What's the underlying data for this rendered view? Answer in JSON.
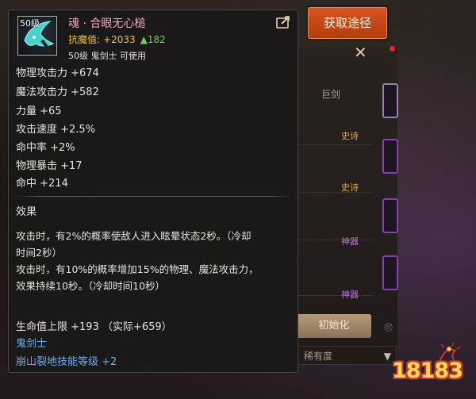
{
  "acquire_button": {
    "label": "获取途径"
  },
  "item": {
    "level_badge": "50级",
    "name": "魂 · 合眼无心槌",
    "resist_label": "抗魔值:",
    "resist_value": "+2033",
    "resist_change": "▲182",
    "level_line": "50级 鬼剑士 可使用",
    "stats": [
      "物理攻击力 +674",
      "魔法攻击力 +582",
      "力量 +65",
      "攻击速度 +2.5%",
      "命中率 +2%",
      "物理暴击 +17",
      "命中 +214"
    ],
    "effect_title": "效果",
    "effect_desc_1": [
      "攻击时，有2%的概率使敌人进入眩晕状态2秒。（冷却",
      "时间2秒）"
    ],
    "effect_desc_2": [
      "攻击时，有10%的概率增加15%的物理、魔法攻击力，",
      "效果持续10秒。（冷却时间10秒）"
    ],
    "hp_line": "生命值上限 +193 （实际+659）",
    "class_line": "鬼剑士",
    "skill_line": "崩山裂地技能等级 +2"
  },
  "background": {
    "column_label": "巨剑",
    "tags": [
      {
        "text": "史诗",
        "color": "#e8a43a"
      },
      {
        "text": "史诗",
        "color": "#e8a43a"
      },
      {
        "text": "神器",
        "color": "#c66ae0"
      },
      {
        "text": "神器",
        "color": "#c66ae0"
      }
    ],
    "upgrade_button": "初始化",
    "sort_select": "稀有度",
    "close_glyph": "✕",
    "scroll_glyph": "◎"
  },
  "watermark": {
    "text": "18183"
  }
}
